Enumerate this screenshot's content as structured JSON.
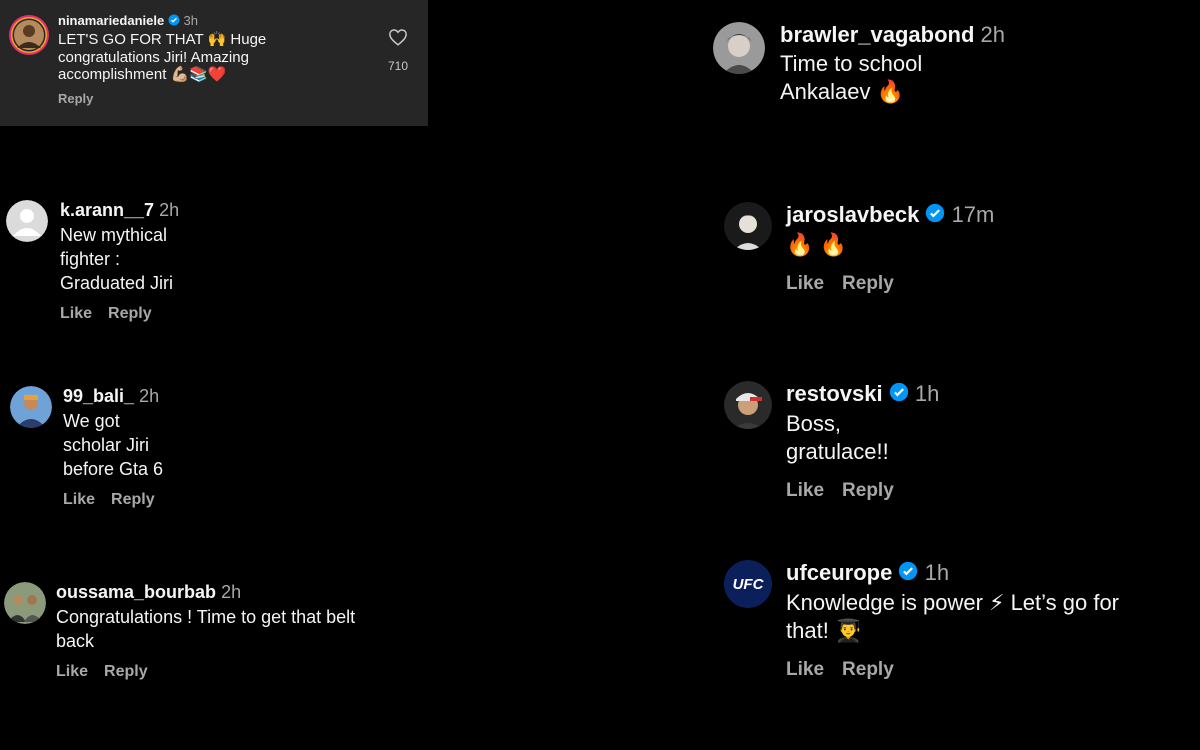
{
  "comments": [
    {
      "username": "ninamariedaniele",
      "time": "3h",
      "text": "LET'S GO FOR THAT 🙌 Huge congratulations Jiri! Amazing accomplishment 💪🏼📚❤️",
      "reply": "Reply",
      "like_count": "710",
      "avatar_icon": "profile-photo"
    },
    {
      "username": "k.arann__7",
      "time": "2h",
      "text": "New mythical fighter : Graduated Jiri",
      "like": "Like",
      "reply": "Reply",
      "avatar_icon": "default-avatar"
    },
    {
      "username": "99_bali_",
      "time": "2h",
      "text": "We got scholar Jiri before Gta 6",
      "like": "Like",
      "reply": "Reply",
      "avatar_icon": "profile-photo"
    },
    {
      "username": "oussama_bourbab",
      "time": "2h",
      "text": "Congratulations ! Time to get that belt back",
      "like": "Like",
      "reply": "Reply",
      "avatar_icon": "profile-photo"
    },
    {
      "username": "brawler_vagabond",
      "time": "2h",
      "text": "Time to school Ankalaev 🔥",
      "avatar_icon": "profile-photo"
    },
    {
      "username": "jaroslavbeck",
      "time": "17m",
      "text": "🔥 🔥",
      "like": "Like",
      "reply": "Reply",
      "avatar_icon": "profile-photo"
    },
    {
      "username": "restovski",
      "time": "1h",
      "text": "Boss, gratulace!!",
      "like": "Like",
      "reply": "Reply",
      "avatar_icon": "profile-photo"
    },
    {
      "username": "ufceurope",
      "time": "1h",
      "text": "Knowledge is power ⚡ Let’s go for that! 👨‍🎓",
      "like": "Like",
      "reply": "Reply",
      "avatar_text": "UFC"
    }
  ],
  "colors": {
    "background": "#000000",
    "highlight": "#262626",
    "verified": "#0095f6",
    "muted": "#a8a8a8"
  }
}
